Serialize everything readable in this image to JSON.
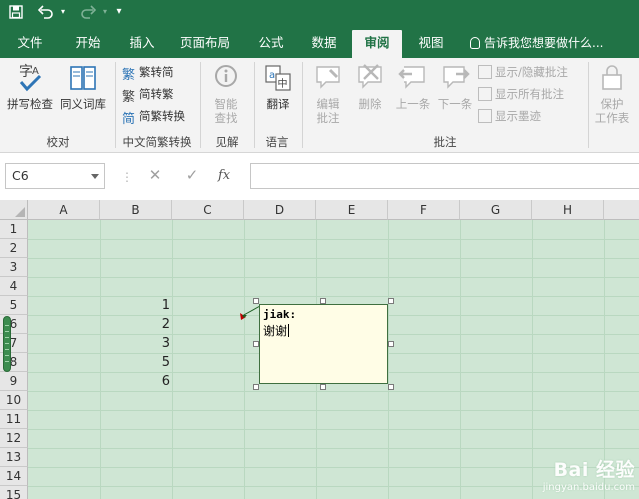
{
  "qat": {
    "save_icon": "save-icon",
    "undo_icon": "undo-icon",
    "redo_icon": "redo-icon",
    "customize_icon": "customize-qat-icon"
  },
  "tabs": [
    {
      "label": "文件"
    },
    {
      "label": "开始"
    },
    {
      "label": "插入"
    },
    {
      "label": "页面布局"
    },
    {
      "label": "公式"
    },
    {
      "label": "数据"
    },
    {
      "label": "审阅"
    },
    {
      "label": "视图"
    }
  ],
  "active_tab": "审阅",
  "tell_me": "告诉我您想要做什么...",
  "ribbon": {
    "spell_check": "拼写检查",
    "thesaurus": "同义词库",
    "to_traditional": "繁转简",
    "to_simplified": "简转繁",
    "convert": "简繁转换",
    "smart_lookup_1": "智能",
    "smart_lookup_2": "查找",
    "translate": "翻译",
    "edit_comment_1": "编辑",
    "edit_comment_2": "批注",
    "delete": "删除",
    "previous": "上一条",
    "next": "下一条",
    "show_hide_comment": "显示/隐藏批注",
    "show_all_comments": "显示所有批注",
    "show_ink": "显示墨迹",
    "protect_1": "保护",
    "protect_2": "工作表",
    "groups": {
      "proofing": "校对",
      "chinese_conversion": "中文简繁转换",
      "insights": "见解",
      "language": "语言",
      "comments": "批注"
    }
  },
  "formula_bar": {
    "name_box": "C6",
    "cancel": "✕",
    "enter": "✓",
    "fx": "fx",
    "formula": ""
  },
  "columns": [
    "A",
    "B",
    "C",
    "D",
    "E",
    "F",
    "G",
    "H"
  ],
  "rows": [
    "1",
    "2",
    "3",
    "4",
    "5",
    "6",
    "7",
    "8",
    "9",
    "10",
    "11",
    "12",
    "13",
    "14",
    "15"
  ],
  "cells_B": [
    "1",
    "2",
    "3",
    "5",
    "6"
  ],
  "comment": {
    "author": "jiak:",
    "text": "谢谢"
  },
  "colors": {
    "excel_green": "#217346",
    "sheet_bg": "#cfe6d4",
    "comment_bg": "#fffde6"
  },
  "watermark": {
    "main": "Bai 经验",
    "sub": "jingyan.baidu.com"
  }
}
